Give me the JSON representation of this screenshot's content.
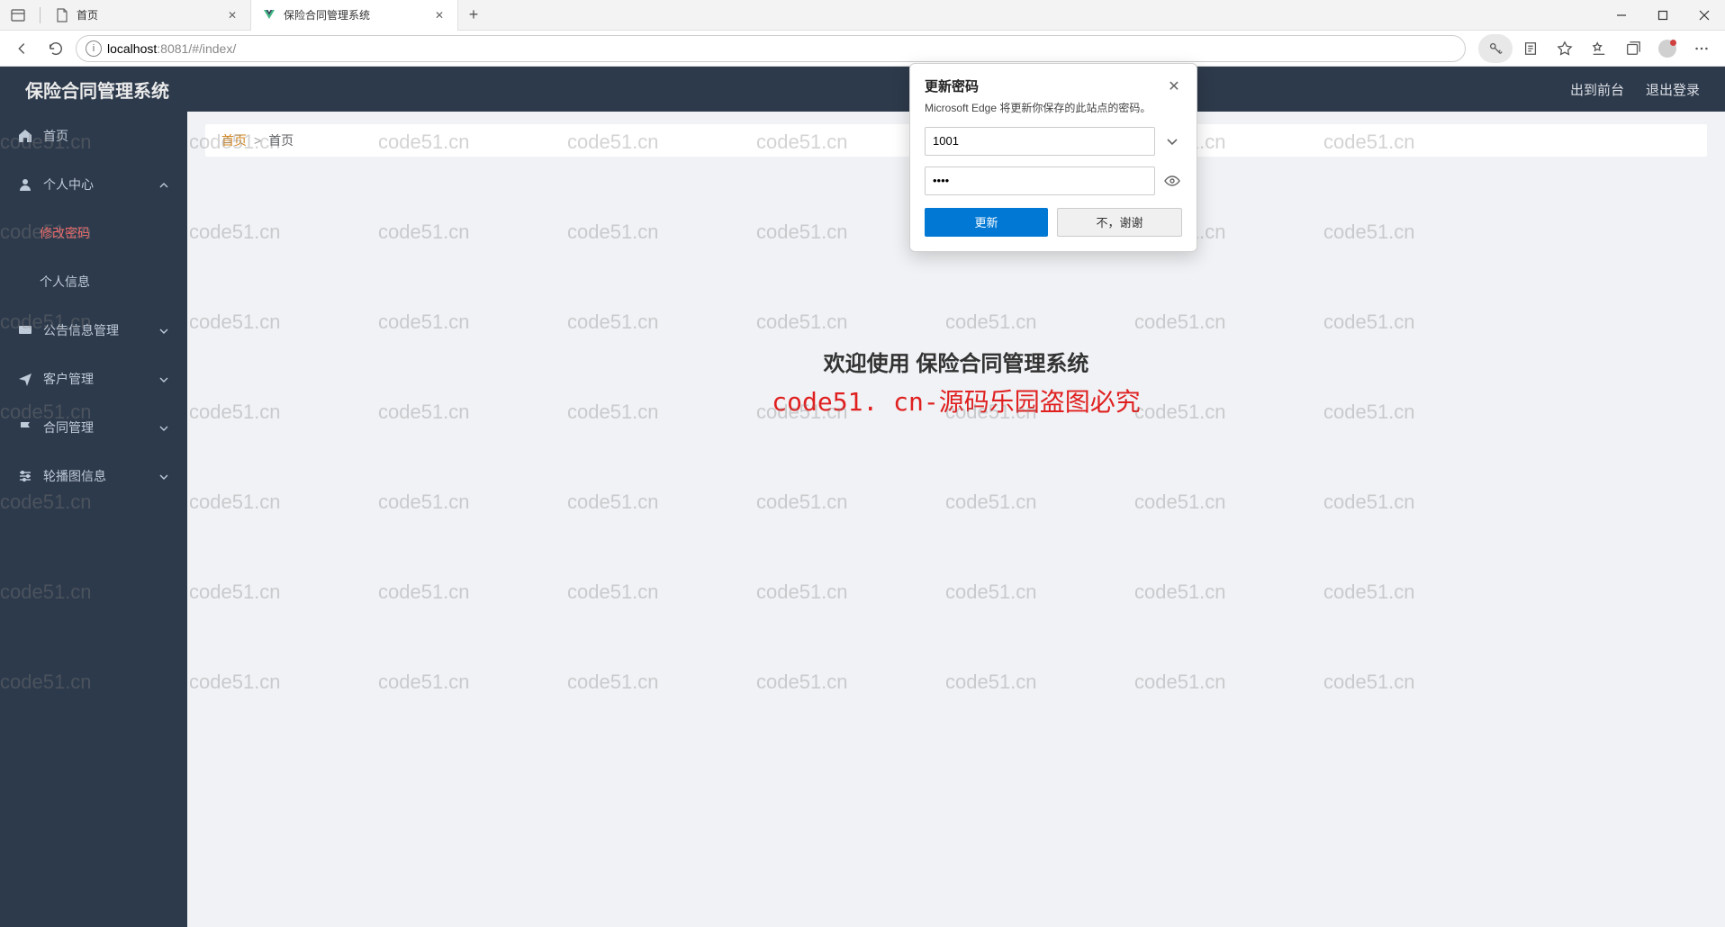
{
  "browser": {
    "tabs": [
      {
        "title": "首页",
        "active": false
      },
      {
        "title": "保险合同管理系统",
        "active": true
      }
    ],
    "url_host": "localhost",
    "url_port": ":8081",
    "url_path": "/#/index/"
  },
  "header": {
    "app_title": "保险合同管理系统",
    "link_front": "出到前台",
    "link_logout": "退出登录"
  },
  "sidebar": {
    "items": [
      {
        "label": "首页",
        "icon": "home",
        "type": "item"
      },
      {
        "label": "个人中心",
        "icon": "user",
        "type": "group",
        "expanded": true
      },
      {
        "label": "修改密码",
        "type": "sub",
        "active": true
      },
      {
        "label": "个人信息",
        "type": "sub",
        "active": false
      },
      {
        "label": "公告信息管理",
        "icon": "message",
        "type": "group",
        "expanded": false
      },
      {
        "label": "客户管理",
        "icon": "send",
        "type": "group",
        "expanded": false
      },
      {
        "label": "合同管理",
        "icon": "flag",
        "type": "group",
        "expanded": false
      },
      {
        "label": "轮播图信息",
        "icon": "sliders",
        "type": "group",
        "expanded": false
      }
    ]
  },
  "breadcrumb": {
    "home": "首页",
    "current": "首页"
  },
  "welcome": {
    "text": "欢迎使用 保险合同管理系统",
    "watermark_center": "code51. cn-源码乐园盗图必究"
  },
  "password_popup": {
    "title": "更新密码",
    "desc": "Microsoft Edge 将更新你保存的此站点的密码。",
    "username": "1001",
    "password_masked": "••••",
    "btn_update": "更新",
    "btn_decline": "不，谢谢"
  },
  "watermark": "code51.cn"
}
